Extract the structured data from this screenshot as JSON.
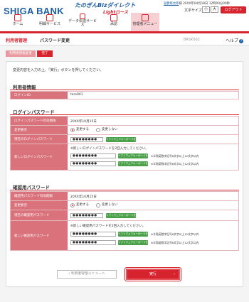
{
  "header": {
    "logo": "SHIGA BANK",
    "brand_main": "たのぎんBizダイレクト",
    "brand_sub": "Lightロース",
    "user_name": "滋賀経太郎",
    "user_suffix": "様",
    "last_login": "20XX年04月18日 12時00分00秒",
    "font_size_label": "文字サイズ",
    "font_small": "小",
    "font_large": "大",
    "logout_label": "ログアウト",
    "accent": "#d6232e",
    "brand_color": "#1f5fa8"
  },
  "nav": {
    "items": [
      {
        "label": "ホーム",
        "icon": "home-icon"
      },
      {
        "label": "明細サービス",
        "icon": "statement-icon"
      },
      {
        "label": "データ伝送サービス",
        "label2": "サービス",
        "icon": "data-transfer-icon"
      },
      {
        "label": "承認",
        "icon": "approval-icon"
      },
      {
        "label": "管理者メニュー",
        "icon": "admin-icon"
      }
    ]
  },
  "page": {
    "crumb_parent": "利用者管理",
    "crumb_title": "パスワード変更",
    "screen_id": "BRSK002",
    "help": "ヘルプ",
    "help_icon": "question-icon",
    "step1": "利用者情報変更",
    "step2": "完了",
    "intro": "変更内容を入力の上、「実行」ボタンを押してください。"
  },
  "user_info": {
    "title": "利用者情報",
    "login_id_label": "ログインID",
    "login_id_value": "taro001"
  },
  "login_pw": {
    "title": "ログインパスワード",
    "expiry_label": "ログインパスワード有効期限",
    "expiry_value": "20XX年10月15日",
    "change_label": "変更要否",
    "change_yes": "変更する",
    "change_no": "変更しない",
    "current_label": "現在のログインパスワード",
    "current_value": "●●●●●●●●",
    "keyboard_label": "ソフトウェアキーボードを開く",
    "new_label": "新しいログインパスワード",
    "new_note": "※新しいログインパスワードを2回入力してください。",
    "new_value": "●●●●●●●●",
    "new_confirm_value": "●●●●●●●●",
    "rule_note": "※半角英数字記号6文字以上12文字以内",
    "rule_note2": "※半角英数字記号6文字以上12文字以内"
  },
  "confirm_pw": {
    "title": "確認用パスワード",
    "expiry_label": "確認用パスワード有効期限",
    "expiry_value": "20XX年10月15日",
    "change_label": "変更要否",
    "change_yes": "変更する",
    "change_no": "変更しない",
    "current_label": "現在の確認用パスワード",
    "current_value": "●●●●●●●●",
    "keyboard_label": "ソフトウェアキーボードを開く",
    "new_label": "新しい確認用パスワード",
    "new_note": "※新しい確認用パスワードを2回入力してください。",
    "new_value": "●●●●●●●●",
    "new_confirm_value": "●●●●●●●●",
    "rule_note": "※半角英数字記号6文字以上12文字以内",
    "rule_note2": "※半角英数字記号6文字以上12文字以内"
  },
  "actions": {
    "back_label": "利用者管理メニューへ",
    "back_icon": "chevron-left-icon",
    "execute_label": "実行",
    "execute_icon": "chevron-right-icon"
  }
}
